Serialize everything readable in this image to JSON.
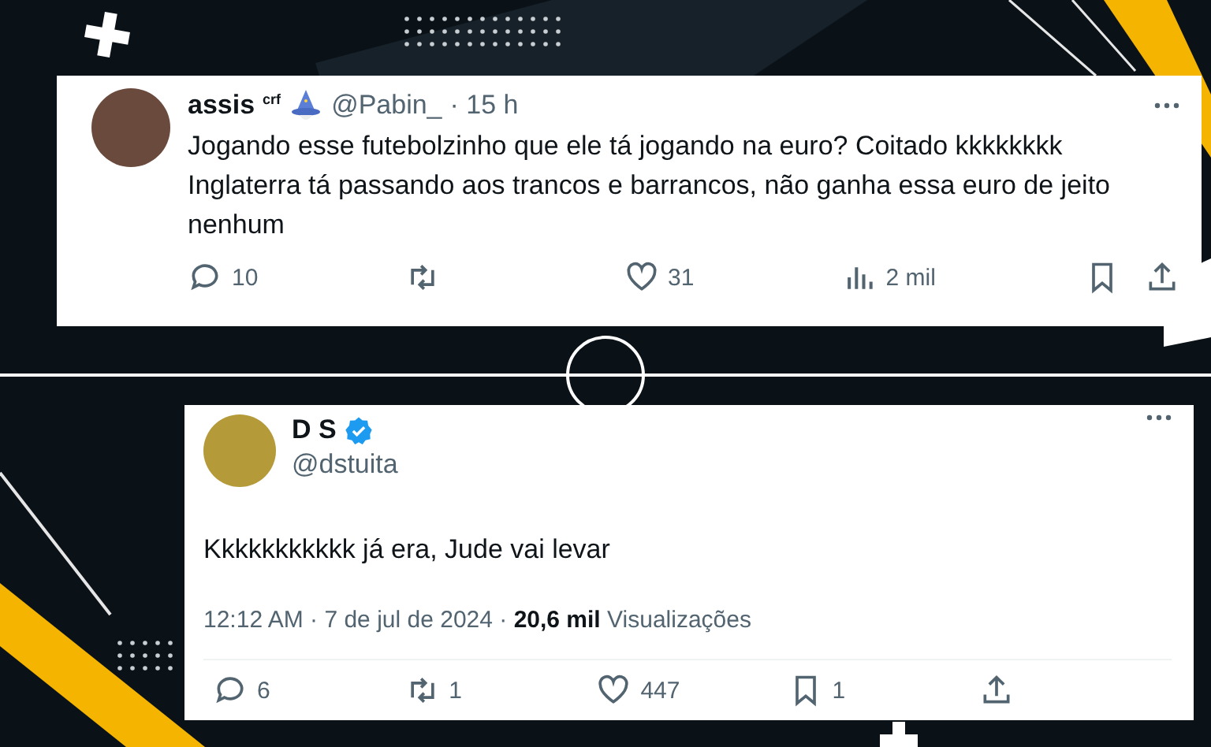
{
  "tweets": [
    {
      "kind": "reply",
      "name": "assis",
      "name_badge": "crf",
      "handle": "@Pabin_",
      "time": "· 15 h",
      "verified": false,
      "text": "Jogando esse futebolzinho que ele tá jogando na euro? Coitado kkkkkkkk Inglaterra tá passando aos trancos e barrancos, não ganha essa euro de jeito nenhum",
      "actions": [
        {
          "kind": "reply",
          "count": "10"
        },
        {
          "kind": "repost"
        },
        {
          "kind": "like",
          "count": "31"
        },
        {
          "kind": "views",
          "count": "2 mil"
        },
        {
          "kind": "bookmark"
        },
        {
          "kind": "share"
        }
      ]
    },
    {
      "kind": "detail",
      "name": "D S",
      "handle": "@dstuita",
      "verified": true,
      "text": "Kkkkkkkkkkk já era, Jude vai levar",
      "timestamp": "12:12 AM · 7 de jul de 2024 ·",
      "views": "20,6 mil",
      "views_label": "Visualizações",
      "actions": [
        {
          "kind": "reply",
          "count": "6"
        },
        {
          "kind": "repost",
          "count": "1"
        },
        {
          "kind": "like",
          "count": "447"
        },
        {
          "kind": "bookmark",
          "count": "1"
        },
        {
          "kind": "share"
        }
      ]
    }
  ]
}
